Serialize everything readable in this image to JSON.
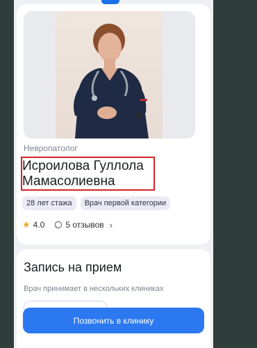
{
  "doctor": {
    "specialty": "Невропатолог",
    "name_line1": "Исроилова Гуллола",
    "name_line2": "Мамасолиевна",
    "tags": [
      "28 лет стажа",
      "Врач первой категории"
    ],
    "rating": "4.0",
    "reviews": "5 отзывов"
  },
  "booking": {
    "title": "Запись на прием",
    "subtitle": "Врач принимает в нескольких клиниках"
  },
  "cta": {
    "label": "Позвонить в клинику"
  },
  "colors": {
    "accent": "#2b78f0",
    "highlight_border": "#d3232a",
    "star": "#f4a623"
  },
  "icons": {
    "rating": "star-icon",
    "reviews": "chat-bubble-icon",
    "more": "chevron-right-icon"
  }
}
